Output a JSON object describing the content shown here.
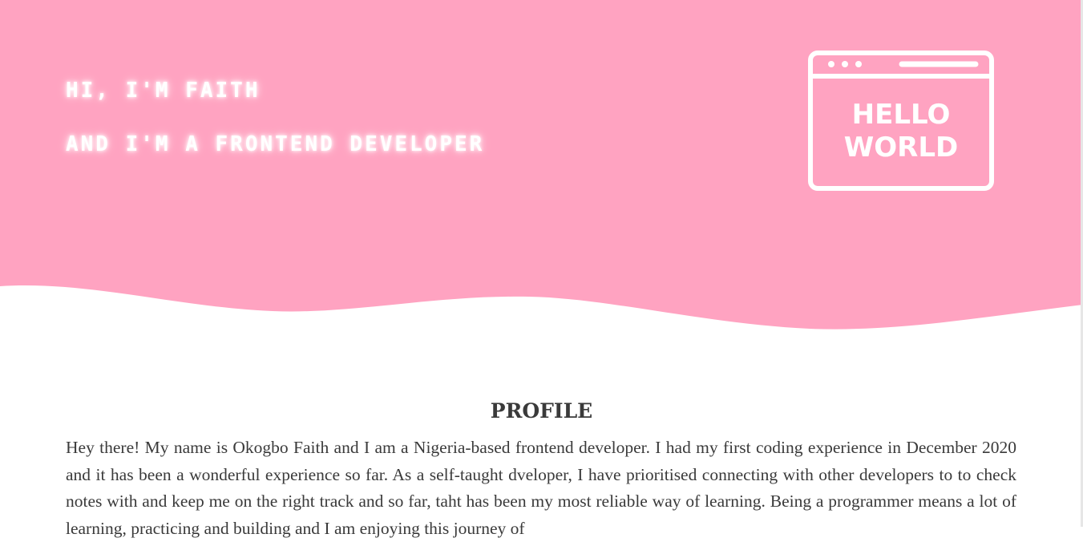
{
  "hero": {
    "greeting": "HI, I'M FAITH",
    "role": "AND I'M A FRONTEND DEVELOPER",
    "icon": "browser-window-icon",
    "icon_text_line1": "HELLO",
    "icon_text_line2": "WORLD",
    "background_color": "#ffa3c1"
  },
  "profile": {
    "heading": "PROFILE",
    "body": "Hey there! My name is Okogbo Faith and I am a Nigeria-based frontend developer. I had my first coding experience in December 2020 and it has been a wonderful experience so far. As a self-taught dveloper, I have prioritised connecting with other developers to to check notes with and keep me on the right track and so far, taht has been my most reliable way of learning. Being a programmer means a lot of learning, practicing and building and I am enjoying this journey of"
  }
}
